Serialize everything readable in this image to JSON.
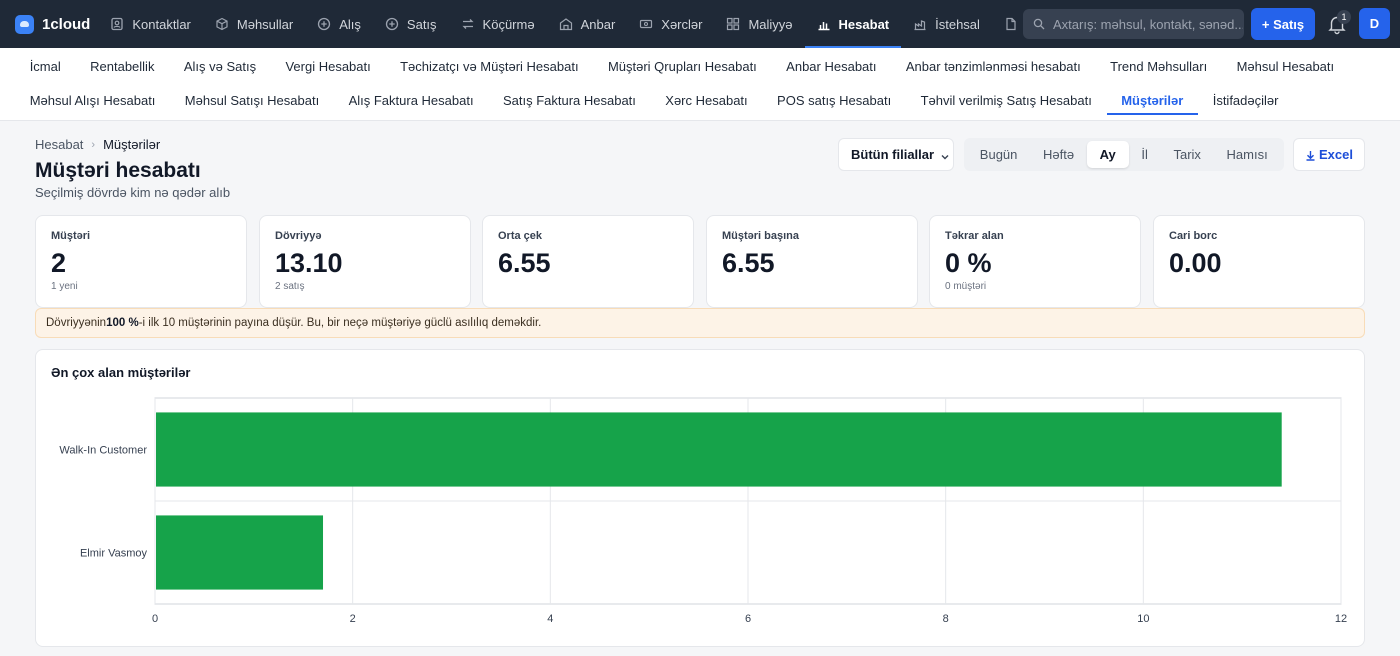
{
  "app": {
    "name": "1cloud"
  },
  "topnav": {
    "items": [
      {
        "label": "Kontaktlar",
        "icon": "contacts-icon"
      },
      {
        "label": "Məhsullar",
        "icon": "box-icon"
      },
      {
        "label": "Alış",
        "icon": "plus-circle-icon"
      },
      {
        "label": "Satış",
        "icon": "minus-circle-icon"
      },
      {
        "label": "Köçürmə",
        "icon": "transfer-icon"
      },
      {
        "label": "Anbar",
        "icon": "warehouse-icon"
      },
      {
        "label": "Xərclər",
        "icon": "money-icon"
      },
      {
        "label": "Maliyyə",
        "icon": "finance-grid-icon"
      },
      {
        "label": "Hesabat",
        "icon": "bar-chart-icon",
        "active": true
      },
      {
        "label": "İstehsal",
        "icon": "factory-icon"
      }
    ],
    "search_placeholder": "Axtarış: məhsul, kontakt, sənəd...",
    "sale_button": "+ Satış",
    "notifications_count": "1",
    "avatar_initial": "D"
  },
  "subnav": {
    "row1": [
      "İcmal",
      "Rentabellik",
      "Alış və Satış",
      "Vergi Hesabatı",
      "Təchizatçı və Müştəri Hesabatı",
      "Müştəri Qrupları Hesabatı",
      "Anbar Hesabatı",
      "Anbar tənzimlənməsi hesabatı",
      "Trend Məhsulları",
      "Məhsul Hesabatı"
    ],
    "row2": [
      "Məhsul Alışı Hesabatı",
      "Məhsul Satışı Hesabatı",
      "Alış Faktura Hesabatı",
      "Satış Faktura Hesabatı",
      "Xərc Hesabatı",
      "POS satış Hesabatı",
      "Təhvil verilmiş Satış Hesabatı",
      "Müştərilər",
      "İstifadəçilər"
    ],
    "active": "Müştərilər"
  },
  "breadcrumb": [
    "Hesabat",
    "Müştərilər"
  ],
  "page": {
    "title": "Müştəri hesabatı",
    "subtitle": "Seçilmiş dövrdə kim nə qədər alıb"
  },
  "filters": {
    "branch": "Bütün filiallar",
    "periods": [
      "Bugün",
      "Həftə",
      "Ay",
      "İl",
      "Tarix",
      "Hamısı"
    ],
    "active_period": "Ay",
    "export_label": "Excel"
  },
  "kpis": [
    {
      "label": "Müştəri",
      "value": "2",
      "sub": "1 yeni"
    },
    {
      "label": "Dövriyyə",
      "value": "13.10",
      "sub": "2 satış"
    },
    {
      "label": "Orta çek",
      "value": "6.55",
      "sub": ""
    },
    {
      "label": "Müştəri başına",
      "value": "6.55",
      "sub": ""
    },
    {
      "label": "Təkrar alan",
      "value": "0 %",
      "sub": "0 müştəri"
    },
    {
      "label": "Cari borc",
      "value": "0.00",
      "sub": ""
    }
  ],
  "notice": {
    "prefix": "Dövriyyənin ",
    "highlight": "100 %",
    "suffix": "-i ilk 10 müştərinin payına düşür. Bu, bir neçə müştəriyə güclü asılılıq deməkdir."
  },
  "chart_data": {
    "type": "bar",
    "orientation": "horizontal",
    "title": "Ən çox alan müştərilər",
    "categories": [
      "Walk-In Customer",
      "Elmir Vasmoy"
    ],
    "values": [
      11.4,
      1.7
    ],
    "xlim": [
      0,
      12
    ],
    "xticks": [
      "0",
      "2",
      "4",
      "6",
      "8",
      "10",
      "12"
    ],
    "xlabel": "",
    "ylabel": "",
    "grid": true,
    "bar_color": "#16a34a"
  }
}
